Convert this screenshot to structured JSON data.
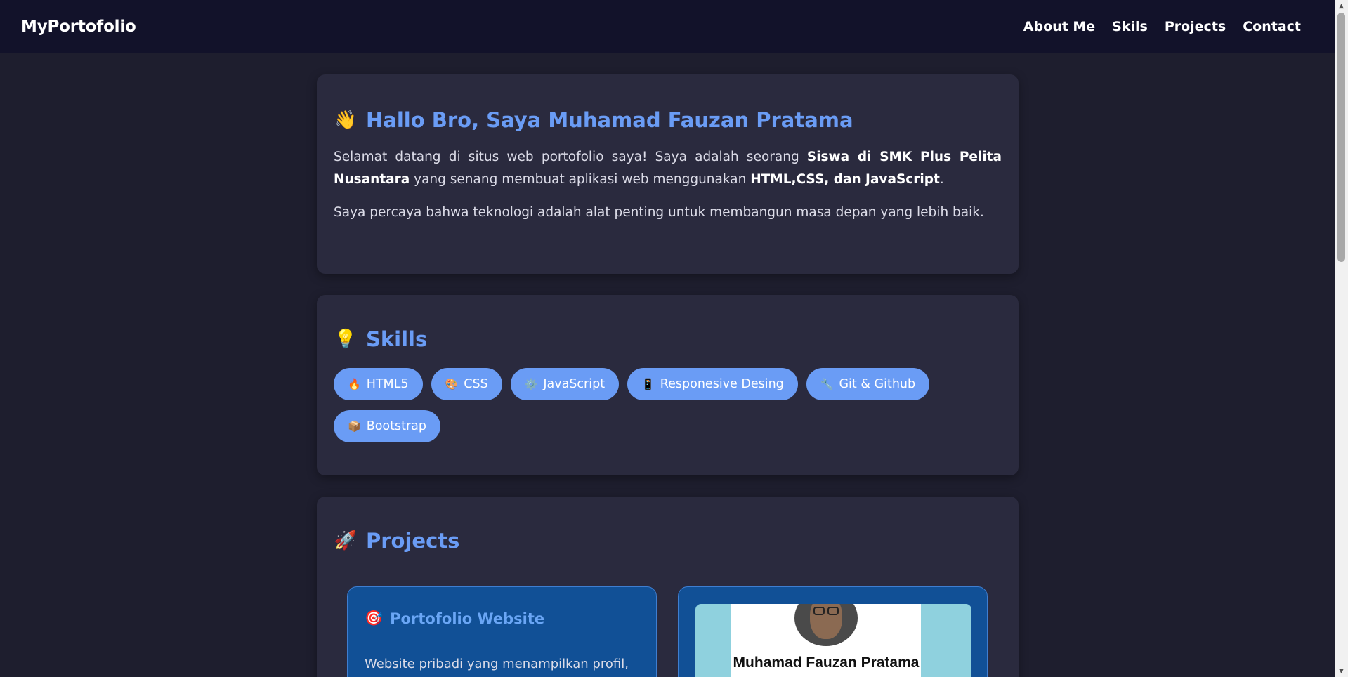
{
  "navbar": {
    "brand": "MyPortofolio",
    "links": [
      "About Me",
      "Skils",
      "Projects",
      "Contact"
    ]
  },
  "about": {
    "emoji": "👋",
    "title_prefix": "Hallo Bro, Saya ",
    "title_name": "Muhamad Fauzan Pratama",
    "p1_a": "Selamat datang di situs web portofolio saya! Saya adalah seorang ",
    "p1_b": "Siswa di SMK Plus Pelita Nusantara",
    "p1_c": " yang senang membuat aplikasi web menggunakan ",
    "p1_d": "HTML,CSS, dan JavaScript",
    "p1_e": ".",
    "p2": "Saya percaya bahwa teknologi adalah alat penting untuk membangun masa depan yang lebih baik."
  },
  "skills": {
    "emoji": "💡",
    "title": "Skills",
    "items": [
      {
        "icon": "🔥",
        "label": "HTML5"
      },
      {
        "icon": "🎨",
        "label": "CSS"
      },
      {
        "icon": "⚙️",
        "label": "JavaScript"
      },
      {
        "icon": "📱",
        "label": "Responesive Desing"
      },
      {
        "icon": "🔧",
        "label": "Git & Github"
      },
      {
        "icon": "📦",
        "label": "Bootstrap"
      }
    ]
  },
  "projects": {
    "emoji": "🚀",
    "title": "Projects",
    "items": [
      {
        "icon": "🎯",
        "title": "Portofolio Website",
        "desc": "Website pribadi yang menampilkan profil,"
      },
      {
        "preview_name": "Muhamad Fauzan Pratama"
      }
    ]
  },
  "colors": {
    "background": "#1e1e2e",
    "navbar": "#12122a",
    "card": "#2a2a3e",
    "accent": "#6a9cf5",
    "project_card": "#115096"
  }
}
